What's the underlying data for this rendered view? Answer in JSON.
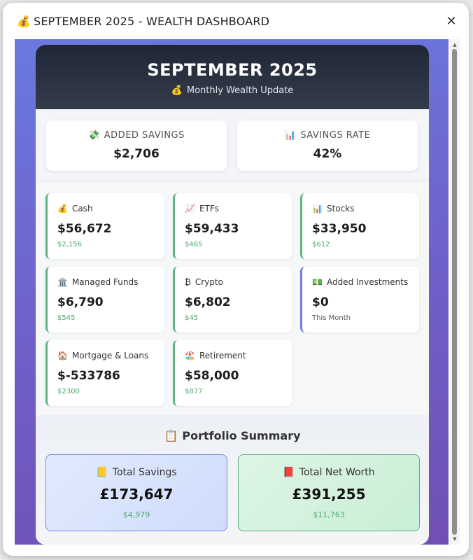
{
  "window": {
    "title_icon": "💰",
    "title": "SEPTEMBER 2025 - WEALTH DASHBOARD",
    "close_label": "✕"
  },
  "hero": {
    "title": "SEPTEMBER 2025",
    "subtitle_icon": "💰",
    "subtitle": "Monthly Wealth Update"
  },
  "top_stats": [
    {
      "icon": "💸",
      "label": "ADDED SAVINGS",
      "value": "$2,706"
    },
    {
      "icon": "📊",
      "label": "SAVINGS RATE",
      "value": "42%"
    }
  ],
  "metrics": [
    {
      "icon": "💰",
      "label": "Cash",
      "value": "$56,672",
      "change": "$2,156"
    },
    {
      "icon": "📈",
      "label": "ETFs",
      "value": "$59,433",
      "change": "$465"
    },
    {
      "icon": "📊",
      "label": "Stocks",
      "value": "$33,950",
      "change": "$612"
    },
    {
      "icon": "🏛️",
      "label": "Managed Funds",
      "value": "$6,790",
      "change": "$545"
    },
    {
      "icon": "₿",
      "label": "Crypto",
      "value": "$6,802",
      "change": "$45"
    },
    {
      "icon": "💵",
      "label": "Added Investments",
      "value": "$0",
      "change": "This Month"
    },
    {
      "icon": "🏠",
      "label": "Mortgage & Loans",
      "value": "$-533786",
      "change": "$2300"
    },
    {
      "icon": "🏖️",
      "label": "Retirement",
      "value": "$58,000",
      "change": "$877"
    }
  ],
  "summary": {
    "icon": "📋",
    "title": "Portfolio Summary",
    "total_savings": {
      "icon": "📒",
      "label": "Total Savings",
      "value": "£173,647",
      "change": "$4,979"
    },
    "total_net_worth": {
      "icon": "📕",
      "label": "Total Net Worth",
      "value": "£391,255",
      "change": "$11,763"
    }
  },
  "scrollbar": {
    "up": "▲",
    "down": "▼"
  },
  "colors": {
    "positive_change": "#4caa6b",
    "accent_border_green": "#5db67d",
    "accent_border_blue": "#6f7de6",
    "hero_bg": "#1f2736"
  }
}
